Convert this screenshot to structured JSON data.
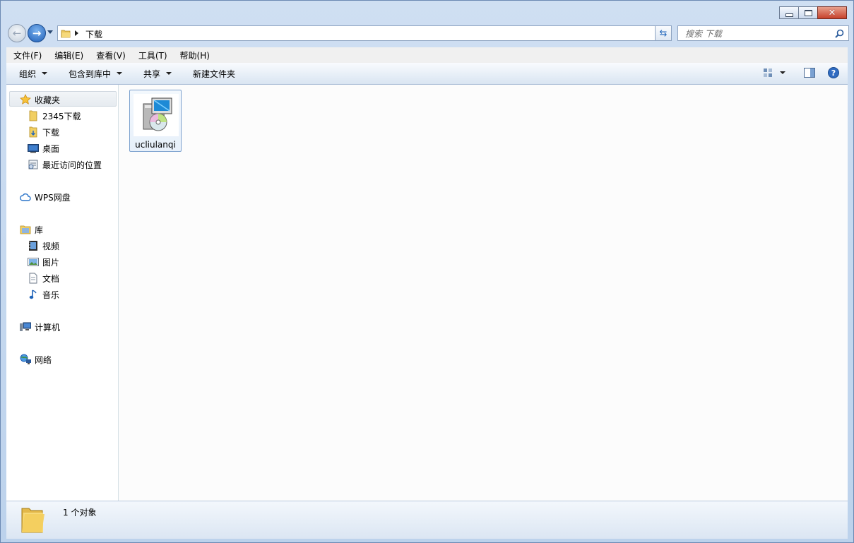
{
  "window": {
    "controls": {
      "minimize": "minimize-icon",
      "maximize": "maximize-icon",
      "close": "✕"
    }
  },
  "navigation": {
    "back_icon": "back-arrow-icon",
    "forward_icon": "forward-arrow-icon",
    "breadcrumb": [
      "下载"
    ],
    "search_placeholder": "搜索 下载"
  },
  "menubar": {
    "items": [
      "文件(F)",
      "编辑(E)",
      "查看(V)",
      "工具(T)",
      "帮助(H)"
    ]
  },
  "toolbar": {
    "organize": "组织",
    "include_in_library": "包含到库中",
    "share": "共享",
    "new_folder": "新建文件夹"
  },
  "sidebar": {
    "favorites": {
      "label": "收藏夹",
      "items": [
        "2345下载",
        "下载",
        "桌面",
        "最近访问的位置"
      ]
    },
    "wps": {
      "label": "WPS网盘"
    },
    "libraries": {
      "label": "库",
      "items": [
        "视频",
        "图片",
        "文档",
        "音乐"
      ]
    },
    "computer": {
      "label": "计算机"
    },
    "network": {
      "label": "网络"
    }
  },
  "files": [
    {
      "name": "ucliulanqi",
      "icon": "installer-icon"
    }
  ],
  "status": {
    "count_text": "1 个对象"
  },
  "colors": {
    "accent": "#1f5fb8",
    "selection_border": "#7da2ce",
    "chrome": "#bcd2ec",
    "close_button": "#c7422c"
  }
}
